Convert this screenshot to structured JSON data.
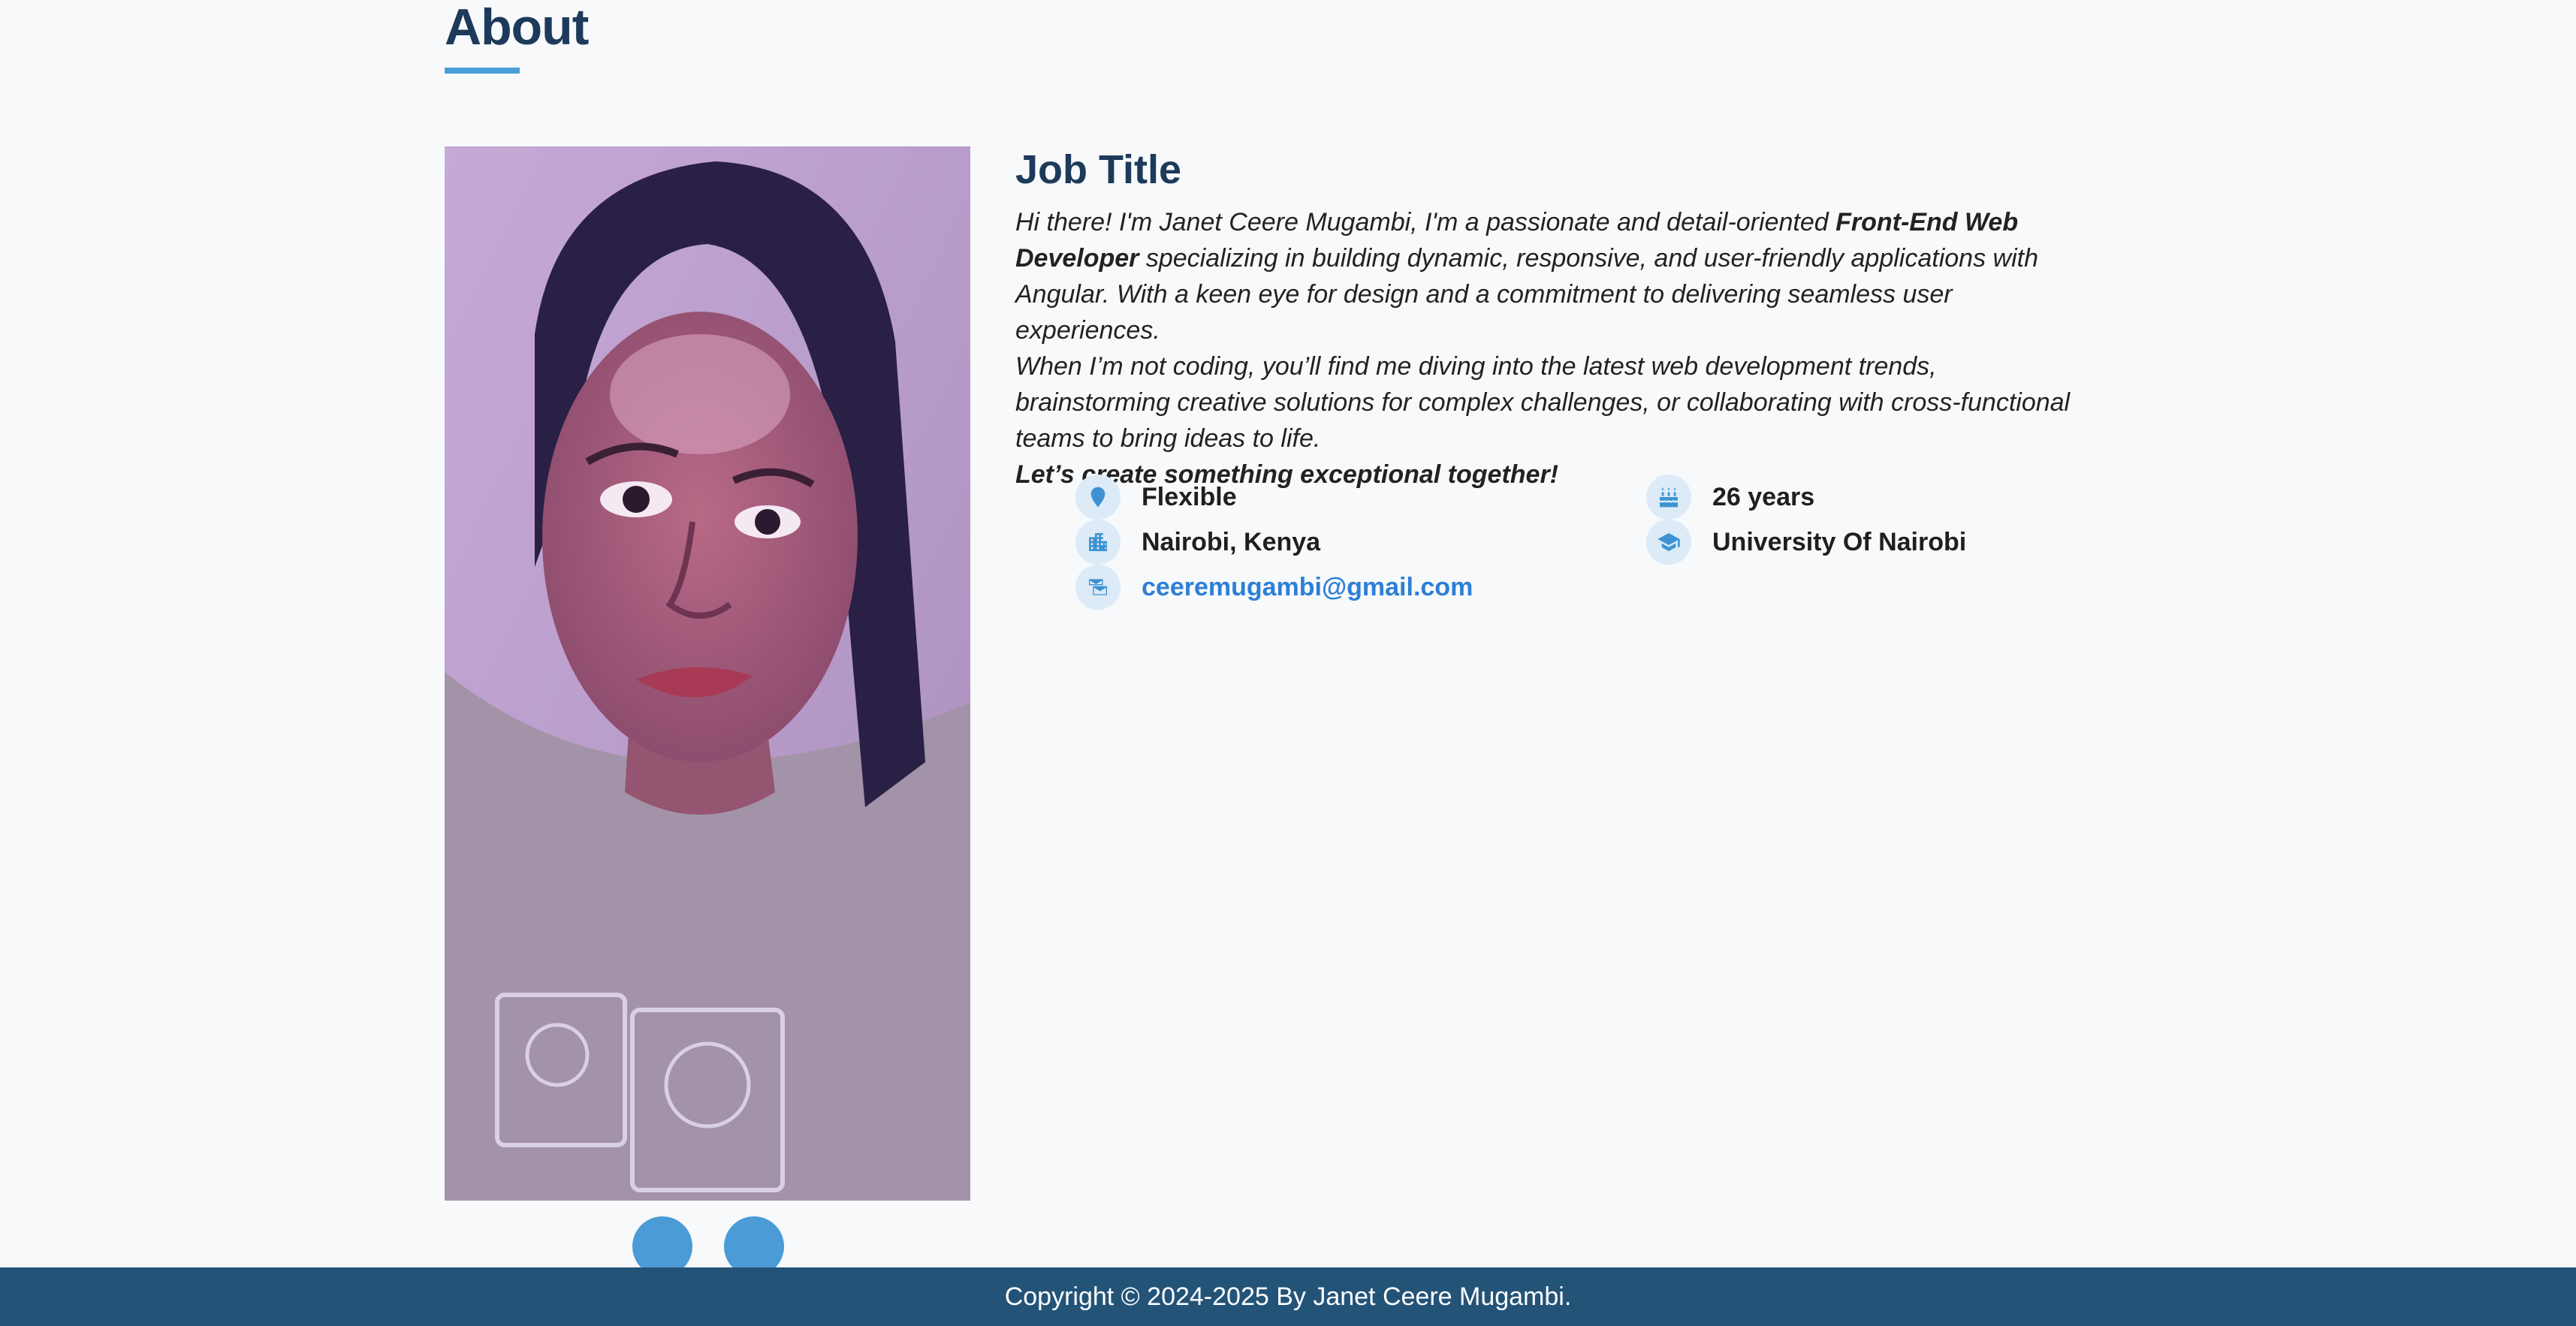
{
  "about": {
    "title": "About",
    "accent_color": "#4a9fd8",
    "photo_alt": "Portrait of Janet Ceere Mugambi"
  },
  "profile": {
    "job_title": "Job Title",
    "bio": {
      "p1_start": "Hi there! I'm Janet Ceere Mugambi, I'm a passionate and detail-oriented ",
      "p1_strong": "Front-End Web Developer",
      "p1_end": " specializing in building dynamic, responsive, and user-friendly applications with Angular. With a keen eye for design and a commitment to delivering seamless user experiences.",
      "p2": "When I’m not coding, you’ll find me diving into the latest web development trends, brainstorming creative solutions for complex challenges, or collaborating with cross-functional teams to bring ideas to life.",
      "p3": "Let’s create something exceptional together!"
    },
    "details": {
      "work_mode": {
        "icon": "location-pin-icon",
        "value": "Flexible"
      },
      "age": {
        "icon": "birthday-cake-icon",
        "value": "26 years"
      },
      "city": {
        "icon": "city-buildings-icon",
        "value": "Nairobi, Kenya"
      },
      "education": {
        "icon": "graduation-cap-icon",
        "value": "University Of Nairobi"
      },
      "email": {
        "icon": "envelope-icon",
        "value": "ceeremugambi@gmail.com"
      }
    }
  },
  "carousel": {
    "dots": 2,
    "dot_color": "#4a9bd6"
  },
  "footer": {
    "text": "Copyright © 2024-2025 By Janet Ceere Mugambi.",
    "background": "#235377"
  }
}
